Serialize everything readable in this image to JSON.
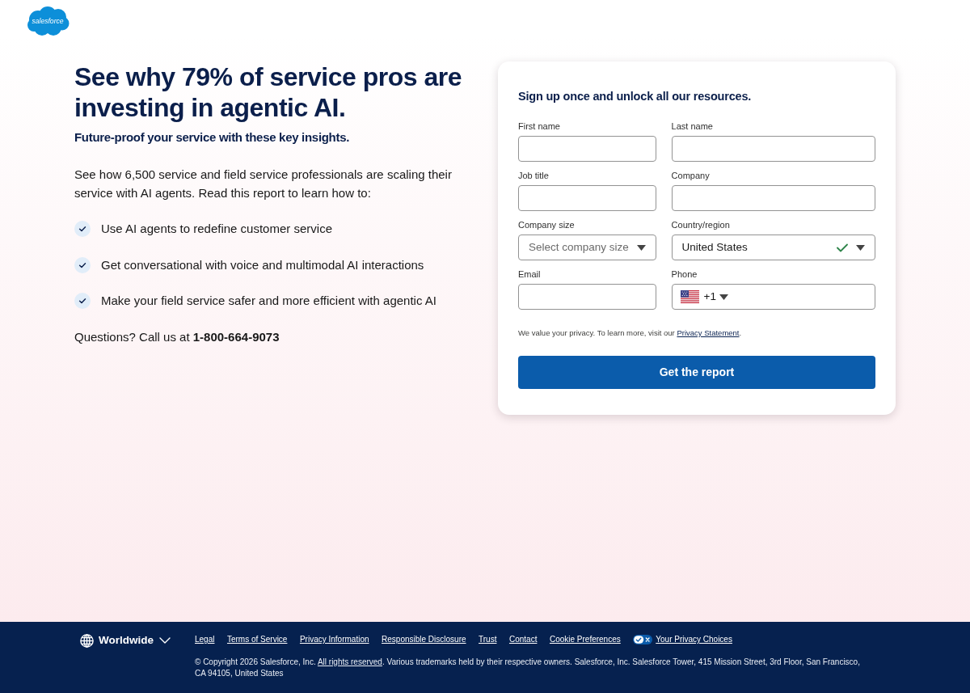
{
  "logo": {
    "text": "salesforce"
  },
  "hero": {
    "title": "See why 79% of service pros are investing in agentic AI.",
    "subtitle": "Future-proof your service with these key insights.",
    "intro": "See how 6,500 service and field service professionals are scaling their service with AI agents. Read this report to learn how to:",
    "benefits": [
      "Use AI agents to redefine customer service",
      "Get conversational with voice and multimodal AI interactions",
      "Make your field service safer and more efficient with agentic AI"
    ],
    "contact": "Questions? Call us at **1-800-664-9073**"
  },
  "form": {
    "title": "Sign up once and unlock all our resources.",
    "fields": [
      {
        "label": "First name",
        "kind": "text"
      },
      {
        "label": "Last name",
        "kind": "text"
      },
      {
        "label": "Job title",
        "kind": "text"
      },
      {
        "label": "Company",
        "kind": "text"
      },
      {
        "label": "Company size",
        "kind": "select",
        "placeholder": "Select company size"
      },
      {
        "label": "Country/region",
        "kind": "select",
        "value": "United States",
        "valid": true
      },
      {
        "label": "Email",
        "kind": "text"
      },
      {
        "label": "Phone",
        "kind": "phone",
        "dial_code": "+1"
      }
    ],
    "privacy_note": {
      "text": "We value your privacy. To learn more, visit our",
      "link": "Privacy Statement",
      "end": "."
    },
    "submit": "Get the report"
  },
  "footer": {
    "region": "Worldwide",
    "links": [
      {
        "text": "Legal",
        "kind": "plain"
      },
      {
        "text": "Terms of Service",
        "kind": "plain"
      },
      {
        "text": "Privacy Information",
        "kind": "plain"
      },
      {
        "text": "Responsible Disclosure",
        "kind": "plain"
      },
      {
        "text": "Trust",
        "kind": "plain"
      },
      {
        "text": "Contact",
        "kind": "plain"
      },
      {
        "text": "Cookie Preferences",
        "kind": "plain"
      },
      {
        "text": "Your Privacy Choices",
        "kind": "privacy"
      }
    ],
    "copyright": {
      "before": "© Copyright 2026 Salesforce, Inc.",
      "link": "All rights reserved",
      "after": ". Various trademarks held by their respective owners. Salesforce, Inc. Salesforce Tower, 415 Mission Street, 3rd Floor, San Francisco, CA 94105, United States"
    }
  }
}
